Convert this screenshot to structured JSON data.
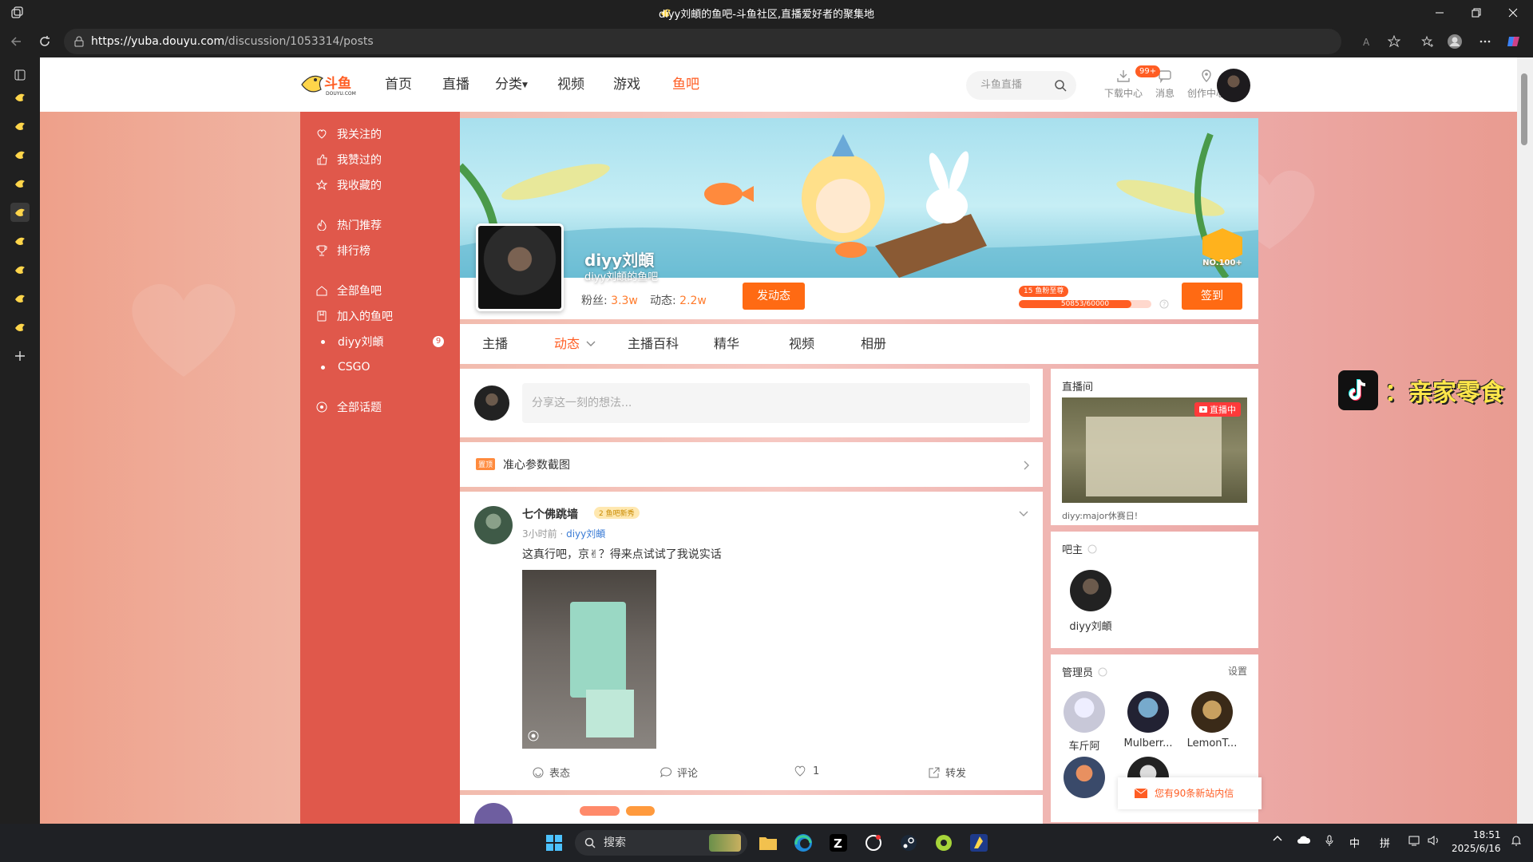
{
  "window": {
    "title": "diyy刘頔的鱼吧-斗鱼社区,直播爱好者的聚集地",
    "url_domain": "https://yuba.douyu.com",
    "url_path": "/discussion/1053314/posts"
  },
  "header": {
    "logo_sub": "DOUYU.COM",
    "nav": [
      "首页",
      "直播",
      "分类",
      "视频",
      "游戏",
      "鱼吧"
    ],
    "search_placeholder": "斗鱼直播",
    "icons": [
      {
        "label": "下载中心",
        "icon": "download-icon"
      },
      {
        "label": "消息",
        "icon": "message-icon"
      },
      {
        "label": "创作中心",
        "icon": "create-icon"
      }
    ],
    "msg_badge": "99+"
  },
  "sidebar": {
    "group1": [
      "我关注的",
      "我赞过的",
      "我收藏的"
    ],
    "group2": [
      "热门推荐",
      "排行榜"
    ],
    "group3": [
      "全部鱼吧",
      "加入的鱼吧"
    ],
    "bars": [
      {
        "label": "diyy刘頔",
        "badge": "9"
      },
      {
        "label": "CSGO",
        "badge": ""
      }
    ],
    "topics": "全部话题"
  },
  "profile": {
    "name": "diyy刘頔",
    "subtitle": "diyy刘頔的鱼吧",
    "fans_label": "粉丝:",
    "fans_value": "3.3w",
    "posts_label": "动态:",
    "posts_value": "2.2w",
    "post_button": "发动态",
    "rank_badge": "NO.100+",
    "level_tag": "15 鱼粉至尊",
    "level_progress": "50853/60000",
    "level_ratio": 0.8476,
    "signin_button": "签到"
  },
  "tabs": [
    "主播",
    "动态",
    "主播百科",
    "精华",
    "视频",
    "相册"
  ],
  "active_tab": "动态",
  "compose": {
    "placeholder": "分享这一刻的想法..."
  },
  "topic": {
    "tag": "置顶",
    "title": "准心参数截图"
  },
  "post": {
    "author": "七个佛跳墙",
    "badge": "2 鱼吧新秀",
    "time": "3小时前",
    "bar": "diyy刘頔",
    "content": "这真行吧，京✌？得来点试试了我说实话",
    "actions": {
      "react": "表态",
      "comment": "评论",
      "like_count": "1",
      "share": "转发"
    }
  },
  "right": {
    "live": {
      "title": "直播间",
      "status": "直播中",
      "caption": "diyy:major休赛日!"
    },
    "owner": {
      "title": "吧主",
      "name": "diyy刘頔"
    },
    "admins": {
      "title": "管理员",
      "settings": "设置",
      "members": [
        "车斤阿",
        "Mulberr...",
        "LemonT..."
      ]
    }
  },
  "overlay": {
    "tiktok_text": "：亲家零食",
    "popup": "您有90条新站内信"
  },
  "taskbar": {
    "search": "搜索",
    "ime": [
      "中",
      "拼"
    ],
    "time": "18:51",
    "date": "2025/6/16"
  },
  "colors": {
    "accent": "#ff5d23",
    "sidebar": "#e0584b",
    "button": "#ff6a13"
  }
}
